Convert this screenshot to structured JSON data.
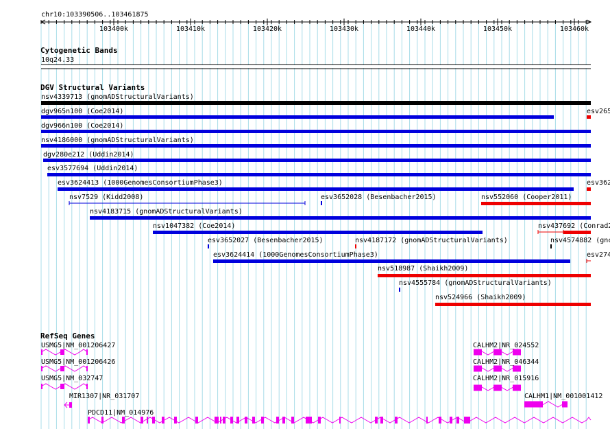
{
  "location": "chr10:103390506..103461875",
  "ruler": {
    "tick_labels": [
      "103400k",
      "103410k",
      "103420k",
      "103430k",
      "103440k",
      "103450k",
      "103460k"
    ]
  },
  "colors": {
    "grid": "#a8dce8",
    "black": "#000000",
    "blue": "#0000dd",
    "red": "#ee0000",
    "magenta": "#ee00ee"
  },
  "tracks": [
    {
      "title": "Cytogenetic Bands",
      "features": [
        {
          "label": "10q24.33",
          "shape": "band",
          "color": "black"
        }
      ]
    },
    {
      "title": "DGV Structural Variants",
      "features": [
        {
          "label": "nsv4339713 (gnomADStructuralVariants)",
          "shape": "bar",
          "color": "black"
        },
        {
          "label": "dgv965n100 (Coe2014)",
          "shape": "bar",
          "color": "blue"
        },
        {
          "label": "esv265",
          "shape": "bar",
          "color": "red"
        },
        {
          "label": "dgv966n100 (Coe2014)",
          "shape": "bar",
          "color": "blue"
        },
        {
          "label": "nsv4186000 (gnomADStructuralVariants)",
          "shape": "bar",
          "color": "blue"
        },
        {
          "label": "dgv280e212 (Uddin2014)",
          "shape": "bar",
          "color": "blue"
        },
        {
          "label": "esv3577694 (Uddin2014)",
          "shape": "bar",
          "color": "blue"
        },
        {
          "label": "esv3624413 (1000GenomesConsortiumPhase3)",
          "shape": "bar",
          "color": "blue"
        },
        {
          "label": "esv362",
          "shape": "bar",
          "color": "red"
        },
        {
          "label": "nsv7529 (Kidd2008)",
          "shape": "span",
          "color": "blue"
        },
        {
          "label": "esv3652028 (Besenbacher2015)",
          "shape": "tick",
          "color": "blue"
        },
        {
          "label": "nsv552060 (Cooper2011)",
          "shape": "bar",
          "color": "red"
        },
        {
          "label": "nsv4183715 (gnomADStructuralVariants)",
          "shape": "bar",
          "color": "blue"
        },
        {
          "label": "nsv1047382 (Coe2014)",
          "shape": "bar",
          "color": "blue"
        },
        {
          "label": "nsv437692 (Conrad2",
          "shape": "span",
          "color": "red"
        },
        {
          "label": "esv3652027 (Besenbacher2015)",
          "shape": "tick",
          "color": "blue"
        },
        {
          "label": "nsv4187172 (gnomADStructuralVariants)",
          "shape": "tick",
          "color": "red"
        },
        {
          "label": "nsv4574882 (gnc",
          "shape": "tick",
          "color": "black"
        },
        {
          "label": "esv3624414 (1000GenomesConsortiumPhase3)",
          "shape": "bar",
          "color": "blue"
        },
        {
          "label": "esv274",
          "shape": "span",
          "color": "red"
        },
        {
          "label": "nsv518987 (Shaikh2009)",
          "shape": "bar",
          "color": "red"
        },
        {
          "label": "nsv4555784 (gnomADStructuralVariants)",
          "shape": "tick",
          "color": "blue"
        },
        {
          "label": "nsv524966 (Shaikh2009)",
          "shape": "bar",
          "color": "red"
        }
      ]
    },
    {
      "title": "RefSeq Genes",
      "features": [
        {
          "label": "USMG5|NM_001206427",
          "shape": "gene",
          "color": "magenta"
        },
        {
          "label": "CALHM2|NR_024552",
          "shape": "gene",
          "color": "magenta"
        },
        {
          "label": "USMG5|NM_001206426",
          "shape": "gene",
          "color": "magenta"
        },
        {
          "label": "CALHM2|NR_046344",
          "shape": "gene",
          "color": "magenta"
        },
        {
          "label": "USMG5|NM_032747",
          "shape": "gene",
          "color": "magenta"
        },
        {
          "label": "CALHM2|NR_015916",
          "shape": "gene",
          "color": "magenta"
        },
        {
          "label": "MIR1307|NR_031707",
          "shape": "gene",
          "color": "magenta"
        },
        {
          "label": "CALHM1|NM_001001412",
          "shape": "gene",
          "color": "magenta"
        },
        {
          "label": "PDCD11|NM_014976",
          "shape": "gene",
          "color": "magenta"
        }
      ]
    }
  ]
}
